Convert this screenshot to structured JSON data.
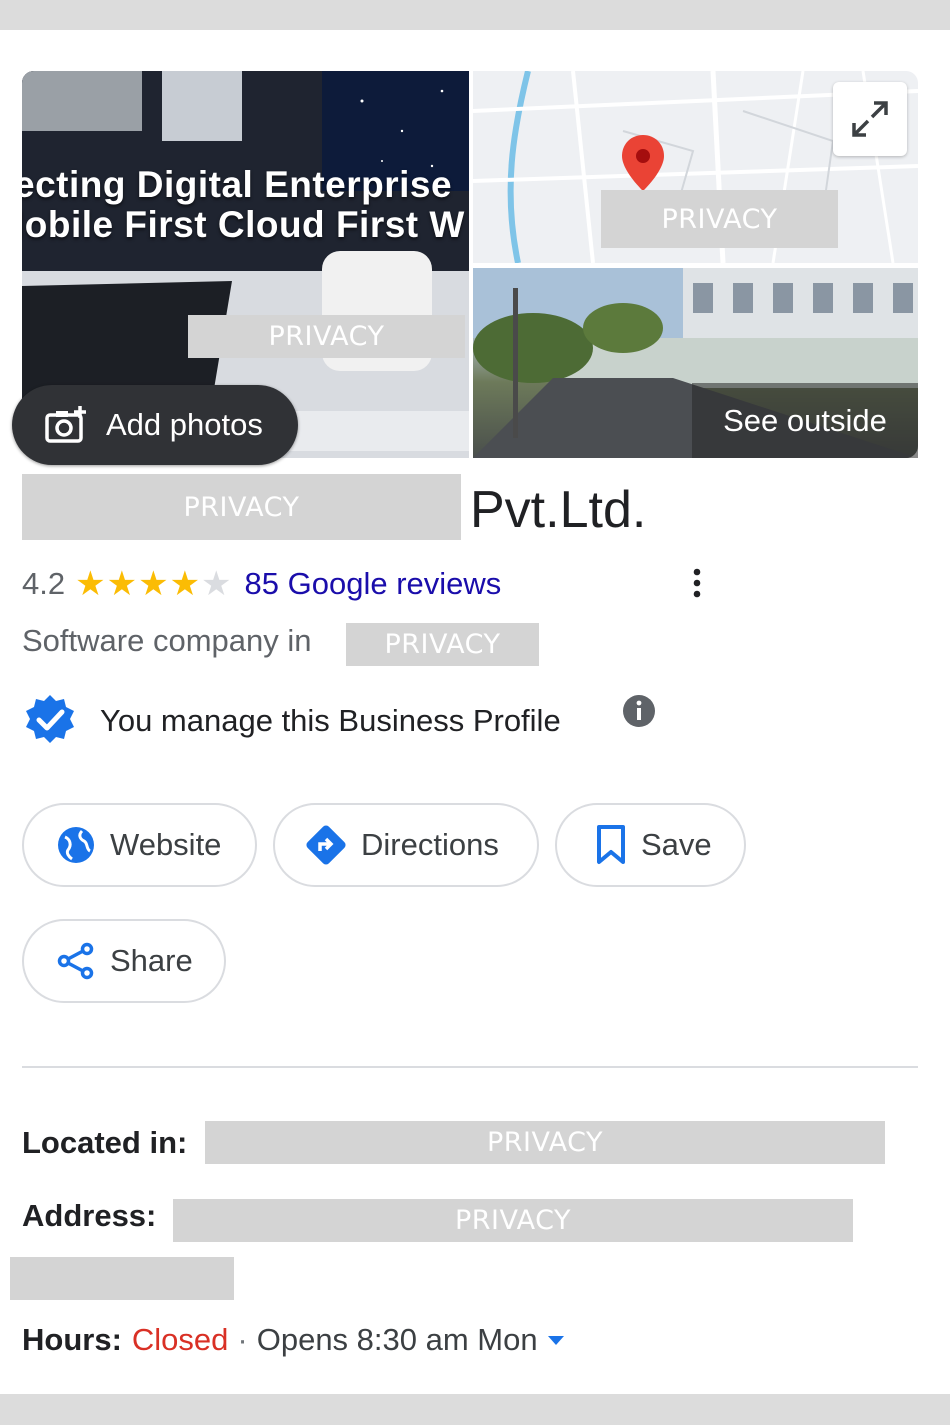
{
  "gallery": {
    "overlay_line1": "ecting Digital Enterprise",
    "overlay_line2": "lobile First Cloud First W",
    "add_photos_label": "Add photos",
    "see_outside_label": "See outside"
  },
  "privacy_label": "PRIVACY",
  "business": {
    "name_suffix": "Pvt.Ltd.",
    "rating": "4.2",
    "stars_filled": 4,
    "stars_total": 5,
    "reviews_link": "85 Google reviews",
    "category_prefix": "Software company in",
    "managed_text": "You manage this Business Profile"
  },
  "actions": {
    "website": "Website",
    "directions": "Directions",
    "save": "Save",
    "share": "Share"
  },
  "details": {
    "located_in_label": "Located in:",
    "address_label": "Address:",
    "hours_label": "Hours:",
    "hours_status": "Closed",
    "hours_separator": "·",
    "hours_next": "Opens 8:30 am Mon"
  },
  "colors": {
    "star": "#fbbc04",
    "star_empty": "#dadce0",
    "link": "#1a0dab",
    "closed": "#d93025",
    "accent_blue": "#1a73e8",
    "map_pin": "#ea4335"
  },
  "icons": [
    "expand-icon",
    "camera-add-icon",
    "map-pin-icon",
    "verified-badge-icon",
    "info-icon",
    "more-vert-icon",
    "globe-icon",
    "directions-icon",
    "bookmark-icon",
    "share-icon",
    "caret-down-icon"
  ]
}
